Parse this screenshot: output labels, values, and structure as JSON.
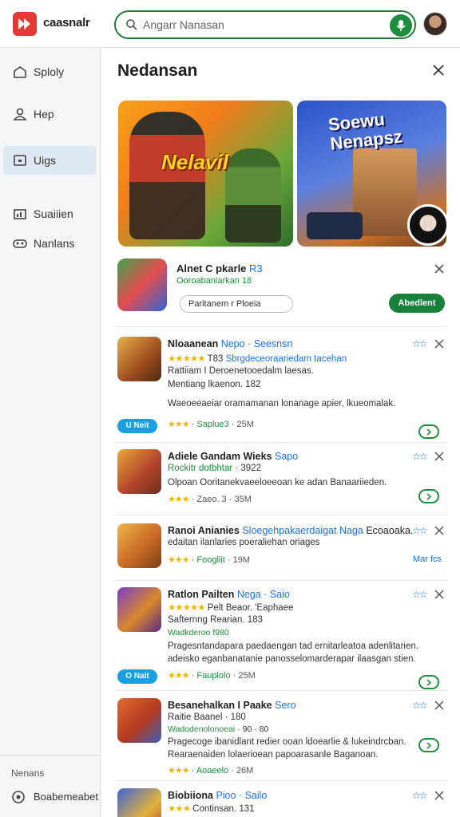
{
  "header": {
    "brand": "caasnalr",
    "search_placeholder": "Angarr Nanasan",
    "icons": {
      "logo": "play-logo-icon",
      "search": "search-icon",
      "mic": "mic-icon",
      "avatar": "user-avatar"
    },
    "colors": {
      "brand_red": "#e53935",
      "accent_green": "#1e7d32"
    }
  },
  "sidebar": {
    "items": [
      {
        "label": "Sploly",
        "icon": "home-icon"
      },
      {
        "label": "Hep",
        "icon": "user-icon"
      },
      {
        "label": "Uigs",
        "icon": "apps-icon",
        "active": true
      },
      {
        "label": "Suaiiien",
        "icon": "chart-icon"
      },
      {
        "label": "Nanlans",
        "icon": "game-icon"
      }
    ],
    "footer_label": "Nenans",
    "footer_item": "Boabemeabet"
  },
  "panel": {
    "title": "Nedansan",
    "banners": [
      {
        "title": "Nelavil"
      },
      {
        "title": "Soewu Nenapsz"
      }
    ],
    "featured": {
      "title": "Alnet C pkarle",
      "title_extra": "R3",
      "subtitle": "Ooroabaniarkan 18",
      "chip": "Paritanem r  Ploeia",
      "button": "Abedlent"
    },
    "apps": [
      {
        "title": "Nloaanean",
        "title_extra": "Nepo · Seesnsn",
        "stars": "★★★★★",
        "line1_extra": "T83",
        "line1_blue": "Sbrgdeceoraariedam tacehan",
        "line2": "Rattiiam I Deroenetooedalm laesas.",
        "line3": "Mentiang lkaenon. 182",
        "desc": "Waeoeeaeiar oramamanan lonanage apier, lkueomalak.",
        "badge": "U Neit",
        "meta_stars": "★★★",
        "meta_green": "Saplue3",
        "meta_size": "25M"
      },
      {
        "title": "Adiele Gandam Wieks",
        "title_extra": "Sapo",
        "line1_green": "Rockitr dotbhtar",
        "line1_extra": "· 3922",
        "desc": "Olpoan Ooritanekvaeeloeeoan ke adan Banaariieden.",
        "meta_stars": "★★★",
        "meta_text": "Zaeo. 3",
        "meta_size": "35M"
      },
      {
        "title": "Ranoi Anianies",
        "title_extra": "Sloegehpakaerdaigat Naga",
        "title_extra2": "Ecoaoaka.",
        "line1": "edaitan ilanlaries poeraliehan oriages",
        "meta_stars": "★★★",
        "meta_green": "Foogliit",
        "meta_size": "19M",
        "more": "Mar fcs"
      },
      {
        "title": "Ratlon Pailten",
        "title_extra": "Nega · Saio",
        "stars": "★★★★★",
        "line1_extra": "Pelt  Beaor. 'Eaphaee",
        "line2": "Safternng Rearian. 183",
        "line3_green": "Wadkderoo f980",
        "desc1": "Pragesntandapara paedaengan tad ernitarleatoa adenlitarien.",
        "desc2": "adeisko eganbanatanie panosselomarderapar ilaasgan stien.",
        "badge": "O Nait",
        "meta_stars": "★★★",
        "meta_green": "Fauplolo",
        "meta_size": "25M"
      },
      {
        "title": "Besanehalkan I Paake",
        "title_extra": "Sero",
        "line1": "Raitie Baanel",
        "line1_extra": "· 180",
        "line2_green": "Wadodenolonoeai",
        "line2_extra": "· 90 · 80",
        "desc1": "Pragecoge ibanidlant redier ooan ldoearlie & lukeindrcban.",
        "desc2": "Rearaenaiden lolaerioean papoarasanle Baganoan.",
        "meta_stars": "★★★",
        "meta_green": "Aoaeelo",
        "meta_size": "26M"
      },
      {
        "title": "Biobiiona",
        "title_extra": "Pioo · Sailo",
        "meta_stars": "★★★",
        "line1": "Continsan. 131"
      }
    ]
  }
}
